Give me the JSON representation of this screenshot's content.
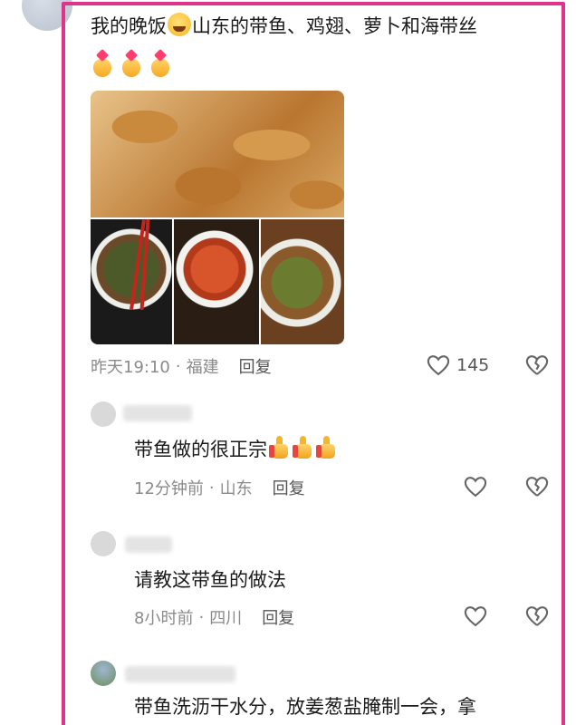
{
  "post": {
    "text_before_emoji": "我的晚饭",
    "text_after_emoji": "山东的带鱼、鸡翅、萝卜和海带丝",
    "time": "昨天19:10",
    "location": "福建",
    "reply_label": "回复",
    "likes": "145",
    "separator": "·"
  },
  "replies": [
    {
      "text": "带鱼做的很正宗",
      "time": "12分钟前",
      "location": "山东",
      "reply_label": "回复"
    },
    {
      "text": "请教这带鱼的做法",
      "time": "8小时前",
      "location": "四川",
      "reply_label": "回复"
    },
    {
      "text": "带鱼洗沥干水分，放姜葱盐腌制一会，拿"
    }
  ],
  "icons": [
    "laughing-emoji-icon",
    "heart-hands-icon",
    "thumbs-up-icon",
    "heart-outline-icon",
    "broken-heart-icon"
  ],
  "colors": {
    "frame": "#e0338a",
    "meta_text": "#8a8a8a",
    "body_text": "#1a1a1a"
  }
}
